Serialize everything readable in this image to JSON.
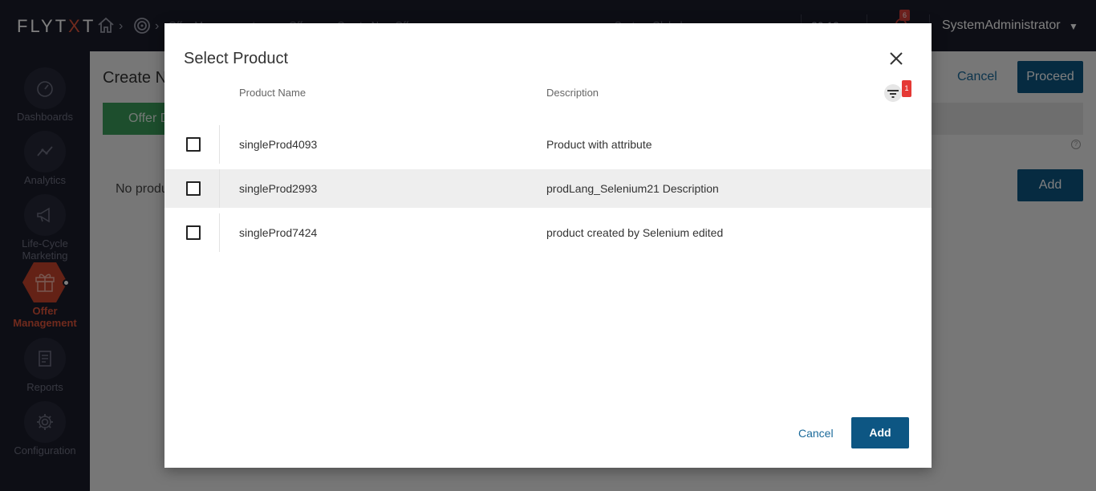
{
  "app": {
    "logo_left": "FLY",
    "logo_mark": "T",
    "logo_x": "X",
    "logo_right": "T"
  },
  "header": {
    "breadcrumbs": [
      "Offer Management",
      "Offers",
      "Create New Offer"
    ],
    "center_label": "System Global",
    "time": "20:19",
    "notification_count": "6",
    "user_name": "SystemAdministrator"
  },
  "sidebar": {
    "items": [
      {
        "label": "Dashboards",
        "icon": "gauge-icon"
      },
      {
        "label": "Analytics",
        "icon": "chart-line-icon"
      },
      {
        "label": "Life-Cycle Marketing",
        "icon": "megaphone-icon"
      },
      {
        "label": "Offer Management",
        "icon": "gift-icon",
        "active": true
      },
      {
        "label": "Reports",
        "icon": "report-icon"
      },
      {
        "label": "Configuration",
        "icon": "gear-icon"
      }
    ]
  },
  "page": {
    "title": "Create New Offer",
    "cancel_label": "Cancel",
    "proceed_label": "Proceed",
    "tab_label": "Offer Details",
    "empty_text": "No products added",
    "add_label": "Add"
  },
  "modal": {
    "title": "Select Product",
    "columns": [
      "Product Name",
      "Description"
    ],
    "filter_count": "1",
    "rows": [
      {
        "name": "singleProd4093",
        "description": "Product with attribute",
        "checked": false
      },
      {
        "name": "singleProd2993",
        "description": "prodLang_Selenium21 Description",
        "checked": false
      },
      {
        "name": "singleProd7424",
        "description": "product created by Selenium edited",
        "checked": false
      }
    ],
    "cancel_label": "Cancel",
    "add_label": "Add"
  },
  "colors": {
    "topbar": "#1b1d2b",
    "accent_orange": "#e0543a",
    "primary_blue": "#0d5683",
    "tab_green": "#3b9d5a",
    "badge_red": "#e53935"
  }
}
